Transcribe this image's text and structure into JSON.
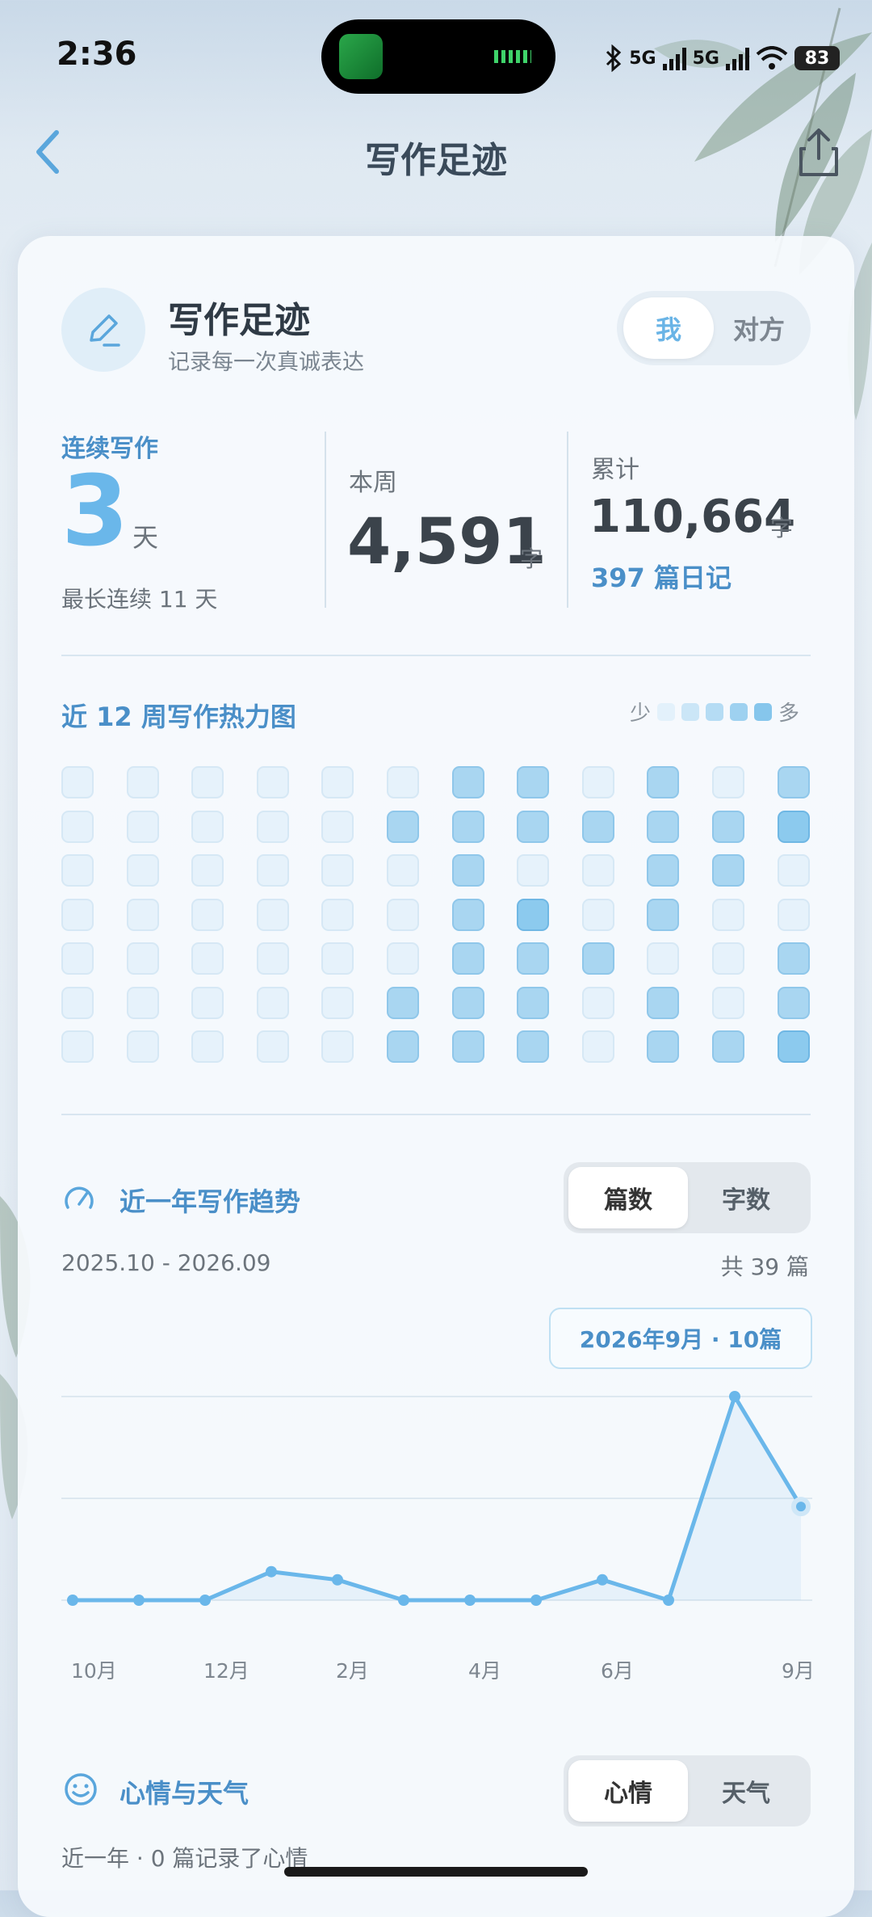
{
  "status": {
    "time": "2:36",
    "net1": "5G",
    "net2": "5G",
    "battery": "83"
  },
  "nav": {
    "title": "写作足迹"
  },
  "header": {
    "title": "写作足迹",
    "subtitle": "记录每一次真诚表达",
    "toggle": [
      "我",
      "对方"
    ],
    "toggle_selected": "我"
  },
  "stats": {
    "streak": {
      "label": "连续写作",
      "value": "3",
      "unit": "天",
      "longest": "最长连续 11 天"
    },
    "week": {
      "label": "本周",
      "value": "4,591",
      "unit": "字"
    },
    "total": {
      "label": "累计",
      "value": "110,664",
      "unit": "字",
      "entries": "397 篇日记"
    }
  },
  "heatmap": {
    "title": "近 12 周写作热力图",
    "legend_less": "少",
    "legend_more": "多",
    "legend_colors": [
      "#e3f1fb",
      "#cbe6f7",
      "#b5dcf4",
      "#9ed1f0",
      "#86c6ec"
    ],
    "levels": [
      [
        0,
        0,
        0,
        0,
        0,
        0,
        2,
        2,
        0,
        2,
        0,
        2
      ],
      [
        0,
        0,
        0,
        0,
        0,
        2,
        2,
        2,
        2,
        2,
        2,
        3
      ],
      [
        0,
        0,
        0,
        0,
        0,
        0,
        2,
        0,
        0,
        2,
        2,
        0
      ],
      [
        0,
        0,
        0,
        0,
        0,
        0,
        2,
        3,
        0,
        2,
        0,
        0
      ],
      [
        0,
        0,
        0,
        0,
        0,
        0,
        2,
        2,
        2,
        0,
        0,
        2
      ],
      [
        0,
        0,
        0,
        0,
        0,
        2,
        2,
        2,
        0,
        2,
        0,
        2
      ],
      [
        0,
        0,
        0,
        0,
        0,
        2,
        2,
        2,
        0,
        2,
        2,
        3
      ]
    ]
  },
  "trend": {
    "title": "近一年写作趋势",
    "tabs": [
      "篇数",
      "字数"
    ],
    "range": "2025.10 - 2026.09",
    "total": "共 39 篇",
    "tooltip": "2026年9月 · 10篇"
  },
  "chart_data": {
    "type": "line",
    "x": [
      "2025-10",
      "2025-11",
      "2025-12",
      "2026-01",
      "2026-02",
      "2026-03",
      "2026-04",
      "2026-05",
      "2026-06",
      "2026-07",
      "2026-08",
      "2026-09"
    ],
    "values": [
      0,
      0,
      0,
      1.4,
      1,
      0,
      0,
      0,
      1,
      0,
      10,
      4.6
    ],
    "tick_labels": [
      "10月",
      "12月",
      "2月",
      "4月",
      "6月",
      "9月"
    ],
    "ylim": [
      0,
      10
    ],
    "grid": true
  },
  "mood": {
    "title": "心情与天气",
    "tabs": [
      "心情",
      "天气"
    ],
    "summary": "近一年 · 0 篇记录了心情"
  }
}
